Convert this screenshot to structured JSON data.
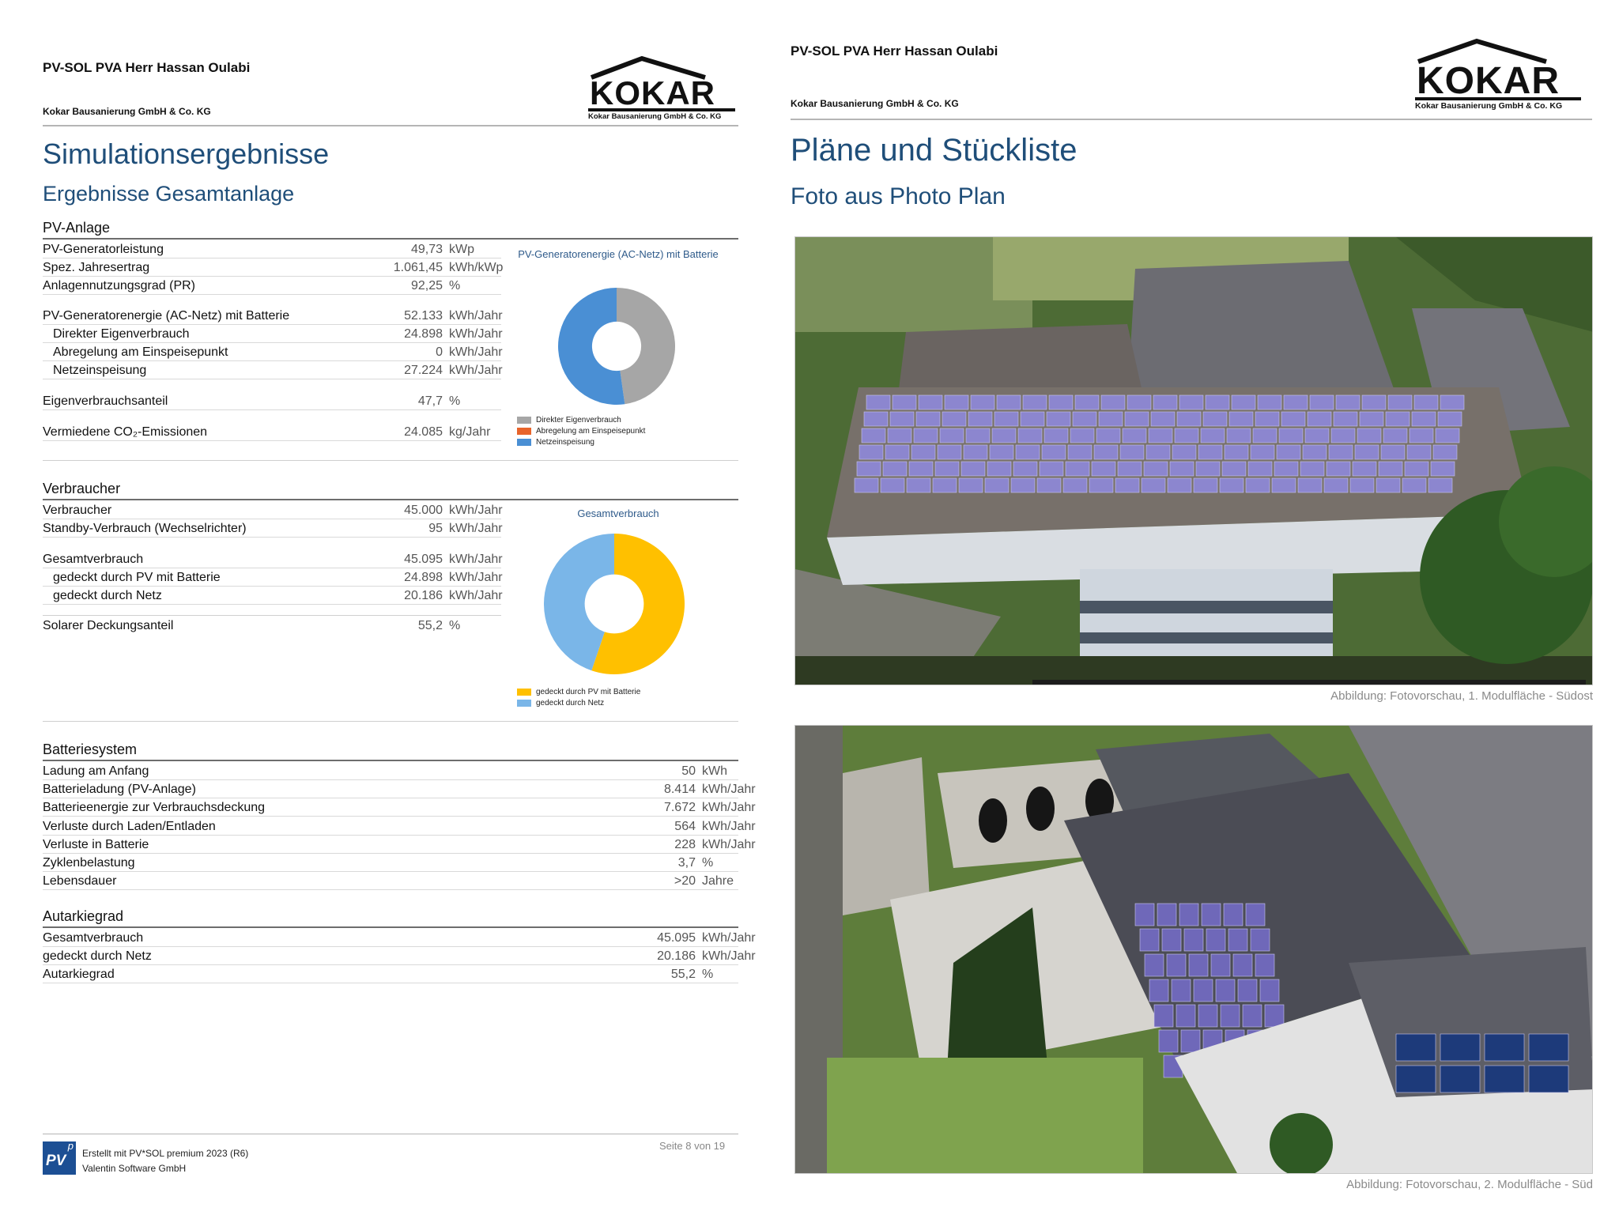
{
  "left": {
    "header_title": "PV-SOL PVA Herr Hassan Oulabi",
    "header_company": "Kokar Bausanierung GmbH & Co. KG",
    "logo_word": "KOKAR",
    "logo_sub": "Kokar Bausanierung GmbH & Co. KG",
    "h1": "Simulationsergebnisse",
    "h2": "Ergebnisse Gesamtanlage",
    "pv": {
      "title": "PV-Anlage",
      "rows": [
        {
          "label": "PV-Generatorleistung",
          "value": "49,73",
          "unit": "kWp"
        },
        {
          "label": "Spez. Jahresertrag",
          "value": "1.061,45",
          "unit": "kWh/kWp"
        },
        {
          "label": "Anlagennutzungsgrad (PR)",
          "value": "92,25",
          "unit": "%"
        },
        {
          "label": "PV-Generatorenergie (AC-Netz) mit Batterie",
          "value": "52.133",
          "unit": "kWh/Jahr"
        },
        {
          "label": "Direkter Eigenverbrauch",
          "value": "24.898",
          "unit": "kWh/Jahr"
        },
        {
          "label": "Abregelung am Einspeisepunkt",
          "value": "0",
          "unit": "kWh/Jahr"
        },
        {
          "label": "Netzeinspeisung",
          "value": "27.224",
          "unit": "kWh/Jahr"
        },
        {
          "label": "Eigenverbrauchsanteil",
          "value": "47,7",
          "unit": "%"
        },
        {
          "label": "Vermiedene CO₂-Emissionen",
          "value": "24.085",
          "unit": "kg/Jahr"
        }
      ],
      "chart_title": "PV-Generatorenergie (AC-Netz) mit Batterie",
      "legend": [
        "Direkter Eigenverbrauch",
        "Abregelung am Einspeisepunkt",
        "Netzeinspeisung"
      ]
    },
    "verbraucher": {
      "title": "Verbraucher",
      "rows": [
        {
          "label": "Verbraucher",
          "value": "45.000",
          "unit": "kWh/Jahr"
        },
        {
          "label": "Standby-Verbrauch (Wechselrichter)",
          "value": "95",
          "unit": "kWh/Jahr"
        },
        {
          "label": "Gesamtverbrauch",
          "value": "45.095",
          "unit": "kWh/Jahr"
        },
        {
          "label": "gedeckt durch PV mit Batterie",
          "value": "24.898",
          "unit": "kWh/Jahr"
        },
        {
          "label": "gedeckt durch Netz",
          "value": "20.186",
          "unit": "kWh/Jahr"
        },
        {
          "label": "Solarer Deckungsanteil",
          "value": "55,2",
          "unit": "%"
        }
      ],
      "chart_title": "Gesamtverbrauch",
      "legend": [
        "gedeckt durch PV mit Batterie",
        "gedeckt durch Netz"
      ]
    },
    "batterie": {
      "title": "Batteriesystem",
      "rows": [
        {
          "label": "Ladung am Anfang",
          "value": "50",
          "unit": "kWh"
        },
        {
          "label": "Batterieladung (PV-Anlage)",
          "value": "8.414",
          "unit": "kWh/Jahr"
        },
        {
          "label": "Batterieenergie zur Verbrauchsdeckung",
          "value": "7.672",
          "unit": "kWh/Jahr"
        },
        {
          "label": "Verluste durch Laden/Entladen",
          "value": "564",
          "unit": "kWh/Jahr"
        },
        {
          "label": "Verluste in Batterie",
          "value": "228",
          "unit": "kWh/Jahr"
        },
        {
          "label": "Zyklenbelastung",
          "value": "3,7",
          "unit": "%"
        },
        {
          "label": "Lebensdauer",
          "value": ">20",
          "unit": "Jahre"
        }
      ]
    },
    "autarkie": {
      "title": "Autarkiegrad",
      "rows": [
        {
          "label": "Gesamtverbrauch",
          "value": "45.095",
          "unit": "kWh/Jahr"
        },
        {
          "label": "gedeckt durch Netz",
          "value": "20.186",
          "unit": "kWh/Jahr"
        },
        {
          "label": "Autarkiegrad",
          "value": "55,2",
          "unit": "%"
        }
      ]
    },
    "footer": {
      "line1": "Erstellt mit PV*SOL premium 2023 (R6)",
      "line2": "Valentin Software GmbH",
      "page": "Seite 8 von 19",
      "logo_text": "PV",
      "logo_sup": "p"
    }
  },
  "right": {
    "header_title": "PV-SOL PVA Herr Hassan Oulabi",
    "header_company": "Kokar Bausanierung GmbH & Co. KG",
    "logo_word": "KOKAR",
    "logo_sub": "Kokar Bausanierung GmbH & Co. KG",
    "h1": "Pläne und Stückliste",
    "h2": "Foto aus Photo Plan",
    "caption1": "Abbildung: Fotovorschau, 1. Modulfläche - Südost",
    "caption2": "Abbildung: Fotovorschau, 2. Modulfläche - Süd"
  },
  "chart_data": [
    {
      "type": "pie",
      "title": "PV-Generatorenergie (AC-Netz) mit Batterie",
      "categories": [
        "Direkter Eigenverbrauch",
        "Abregelung am Einspeisepunkt",
        "Netzeinspeisung"
      ],
      "values": [
        24898,
        0,
        27224
      ],
      "colors": [
        "#a6a6a6",
        "#e8642b",
        "#4a8fd4"
      ]
    },
    {
      "type": "pie",
      "title": "Gesamtverbrauch",
      "categories": [
        "gedeckt durch PV mit Batterie",
        "gedeckt durch Netz"
      ],
      "values": [
        24898,
        20186
      ],
      "colors": [
        "#ffc000",
        "#7ab6e8"
      ]
    }
  ]
}
